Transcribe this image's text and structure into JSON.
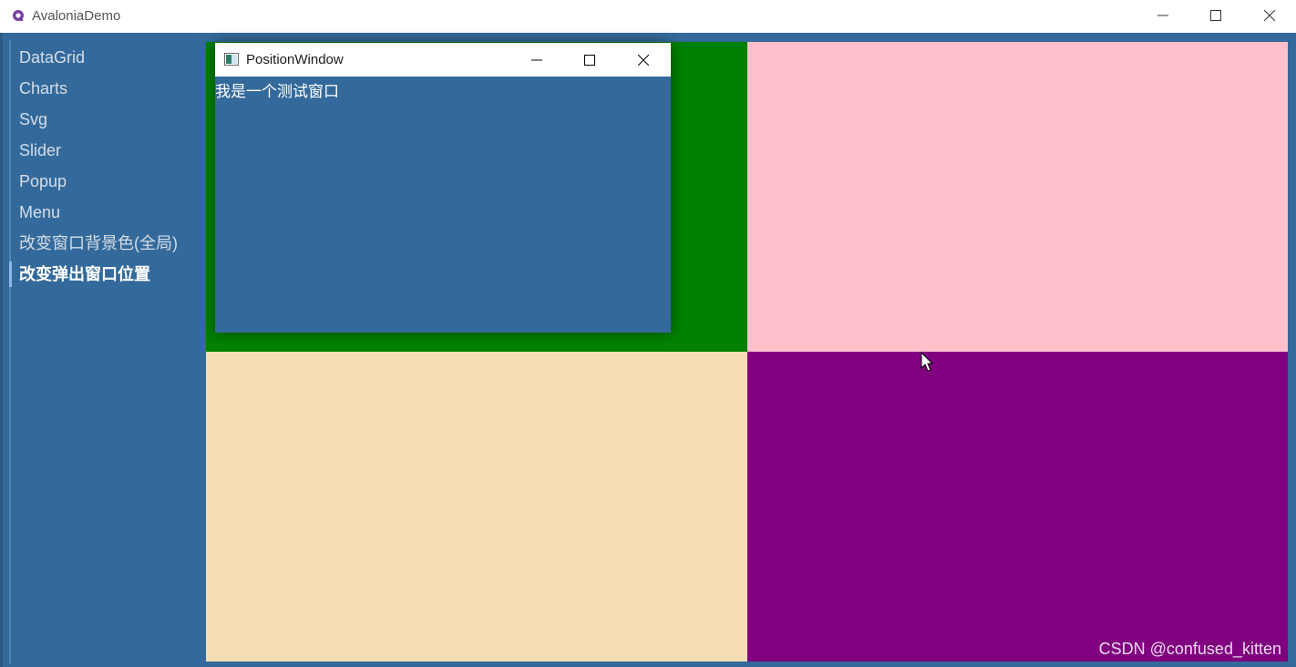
{
  "app": {
    "title": "AvaloniaDemo"
  },
  "sidebar": {
    "items": [
      {
        "label": "DataGrid"
      },
      {
        "label": "Charts"
      },
      {
        "label": "Svg"
      },
      {
        "label": "Slider"
      },
      {
        "label": "Popup"
      },
      {
        "label": "Menu"
      },
      {
        "label": "改变窗口背景色(全局)"
      },
      {
        "label": "改变弹出窗口位置",
        "active": true
      }
    ]
  },
  "content": {
    "quadrants": [
      {
        "name": "top-left",
        "color": "#008000"
      },
      {
        "name": "top-right",
        "color": "#ffc0cb"
      },
      {
        "name": "bottom-left",
        "color": "#f5deb3"
      },
      {
        "name": "bottom-right",
        "color": "#800080"
      }
    ]
  },
  "popup": {
    "title": "PositionWindow",
    "body_text": "我是一个测试窗口"
  },
  "watermark": "CSDN @confused_kitten",
  "colors": {
    "background": "#346a9b",
    "popup_bg": "#346a9b"
  }
}
